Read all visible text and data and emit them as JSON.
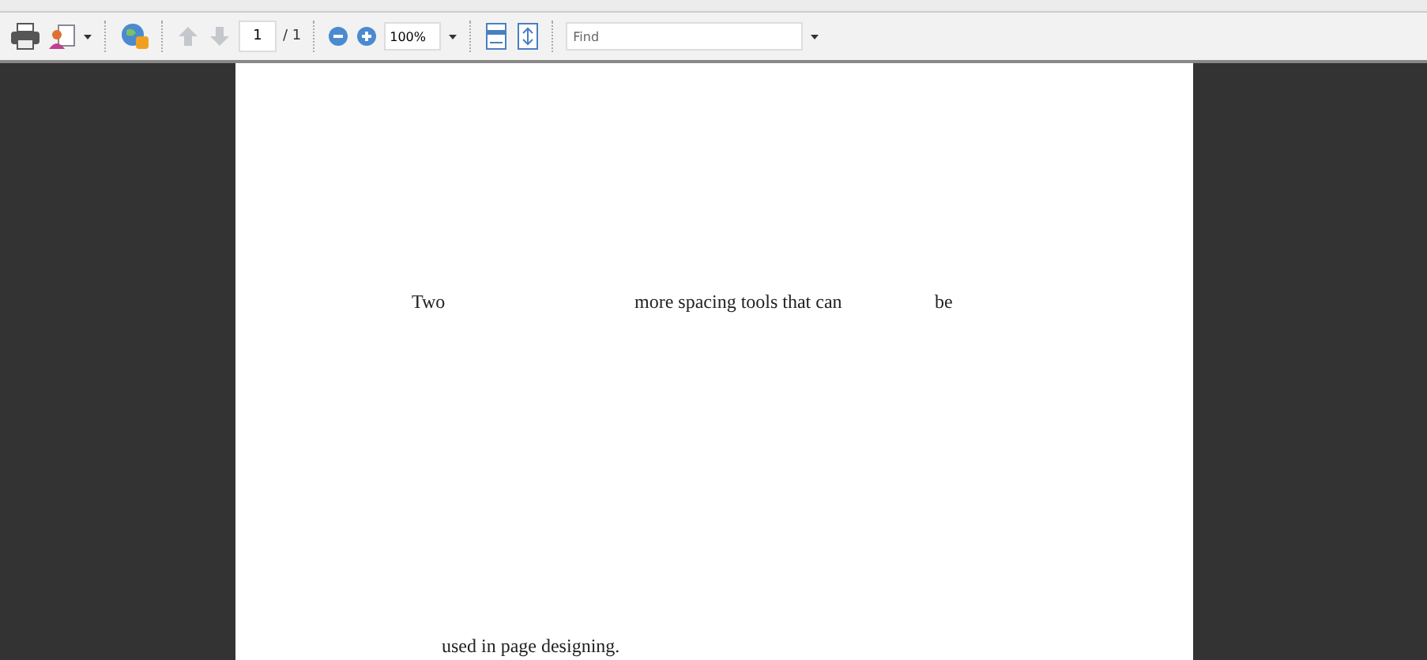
{
  "toolbar": {
    "previous_page": {
      "disabled": true
    },
    "next_page": {
      "disabled": true
    },
    "page_number": "1",
    "page_total": "/ 1",
    "zoom": "100%",
    "find": {
      "placeholder": "Find"
    }
  },
  "document": {
    "lines": [
      {
        "segments": [
          "Two",
          "more spacing tools that can",
          "be"
        ]
      },
      {
        "segments": [
          "used in page designing."
        ]
      }
    ]
  }
}
